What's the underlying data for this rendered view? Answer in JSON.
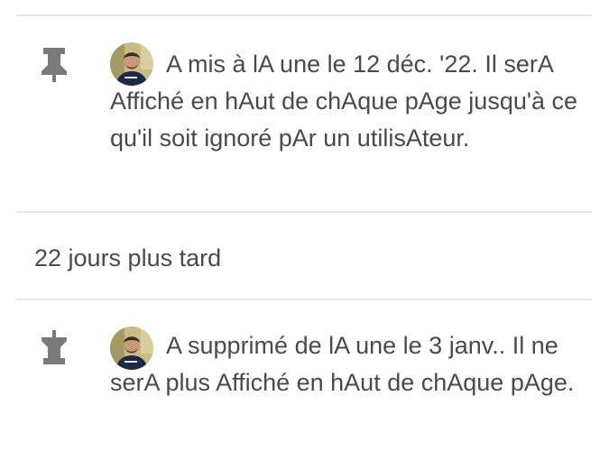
{
  "events": [
    {
      "icon": "pin-icon",
      "message": "A mis à lA une le 12 déc. '22. Il serA Affiché en hAut de chAque pAge jusqu'à ce qu'il soit ignoré pAr un utilisAteur."
    },
    {
      "icon": "unpin-icon",
      "message": "A supprimé de lA une le 3 janv.. Il ne serA plus Affiché en hAut de chAque pAge."
    }
  ],
  "time_gap": "22 jours plus tard",
  "colors": {
    "icon": "#7a7a7a",
    "text": "#4a4a4a",
    "divider": "#e4e4e4"
  }
}
